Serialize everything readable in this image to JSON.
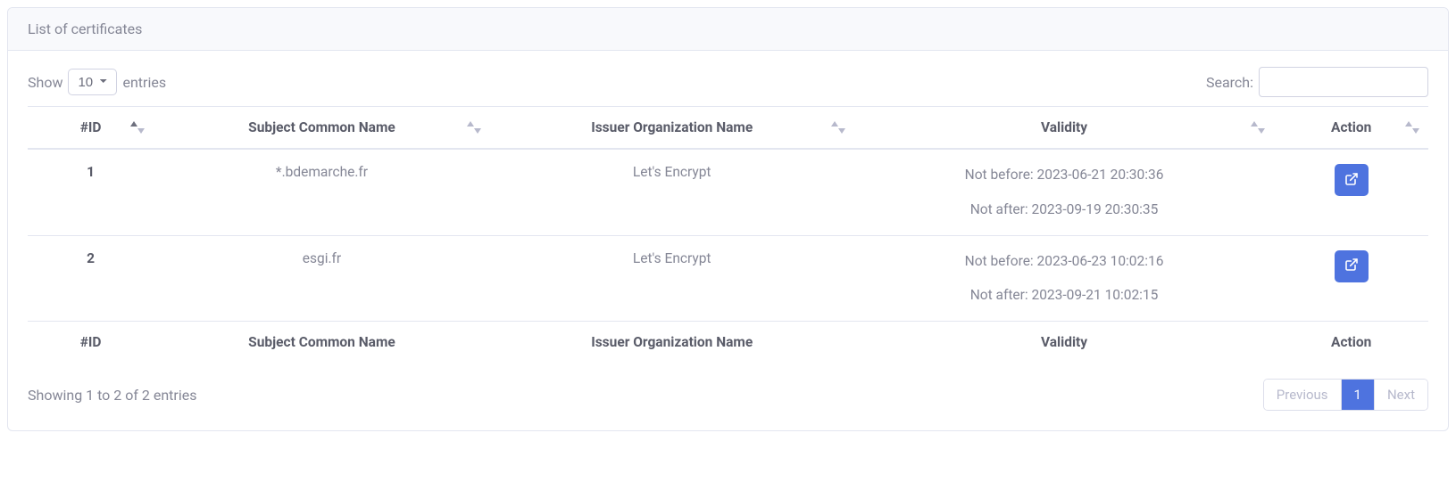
{
  "header": {
    "title": "List of certificates"
  },
  "length": {
    "show_label": "Show",
    "entries_label": "entries",
    "selected": "10"
  },
  "search": {
    "label": "Search:",
    "value": ""
  },
  "columns": {
    "id": "#ID",
    "subject": "Subject Common Name",
    "issuer": "Issuer Organization Name",
    "validity": "Validity",
    "action": "Action"
  },
  "rows": [
    {
      "id": "1",
      "subject": "*.bdemarche.fr",
      "issuer": "Let's Encrypt",
      "not_before": "Not before: 2023-06-21 20:30:36",
      "not_after": "Not after: 2023-09-19 20:30:35"
    },
    {
      "id": "2",
      "subject": "esgi.fr",
      "issuer": "Let's Encrypt",
      "not_before": "Not before: 2023-06-23 10:02:16",
      "not_after": "Not after: 2023-09-21 10:02:15"
    }
  ],
  "info": "Showing 1 to 2 of 2 entries",
  "paginate": {
    "previous": "Previous",
    "next": "Next",
    "page1": "1"
  }
}
